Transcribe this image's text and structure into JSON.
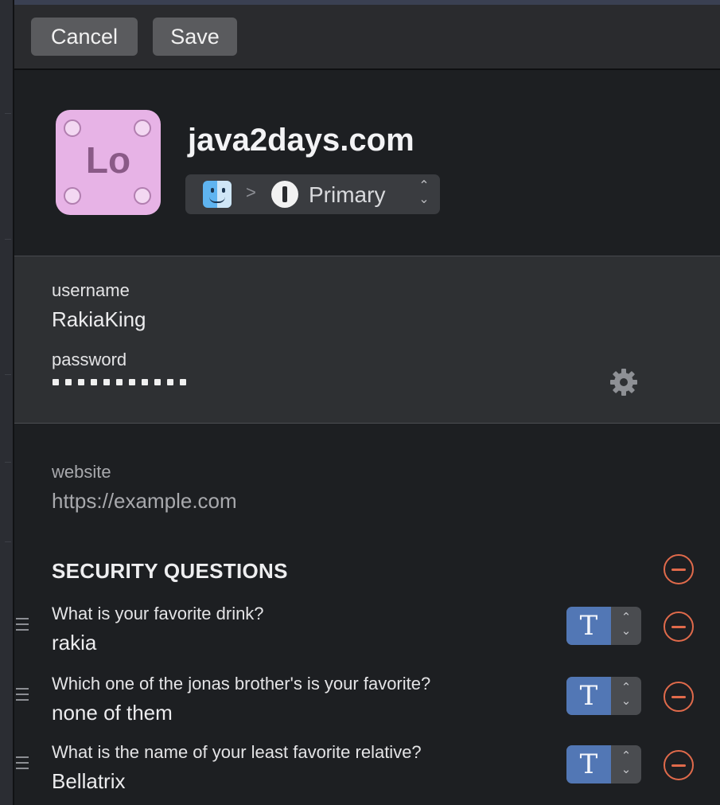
{
  "toolbar": {
    "cancel_label": "Cancel",
    "save_label": "Save"
  },
  "item": {
    "icon_text": "Lo",
    "title": "java2days.com",
    "vault_selector": {
      "app_icon": "finder-icon",
      "separator": ">",
      "vault_icon": "1password-icon",
      "vault_name": "Primary"
    }
  },
  "credentials": {
    "username_label": "username",
    "username_value": "RakiaKing",
    "password_label": "password",
    "password_mask_length": 11,
    "generator_icon": "gear-icon"
  },
  "website": {
    "label": "website",
    "placeholder": "https://example.com"
  },
  "security_questions": {
    "title": "SECURITY QUESTIONS",
    "items": [
      {
        "question": "What is your favorite drink?",
        "answer": "rakia",
        "type": "T"
      },
      {
        "question": "Which one of the jonas brother's is your favorite?",
        "answer": "none of them",
        "type": "T"
      },
      {
        "question": "What is the name of your least favorite relative?",
        "answer": "Bellatrix",
        "type": "T"
      }
    ]
  },
  "colors": {
    "background": "#1d1f22",
    "toolbar": "#2a2b2e",
    "credentials_panel": "#2e3033",
    "remove_accent": "#e06a4b",
    "type_accent": "#5277b5",
    "app_icon_bg": "#e7b3e6"
  }
}
